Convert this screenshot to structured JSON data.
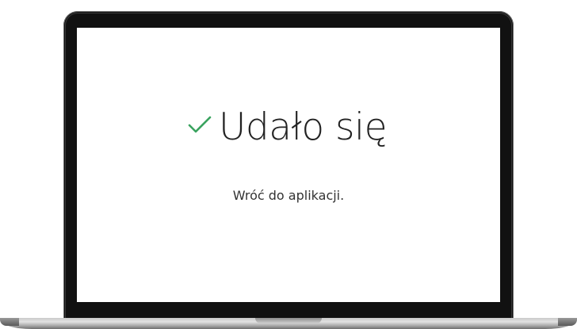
{
  "screen": {
    "title": "Udało się",
    "subtitle": "Wróć do aplikacji."
  },
  "icons": {
    "check": "check-icon"
  },
  "colors": {
    "check": "#3aa35f",
    "title": "#222222",
    "bezel": "#111111",
    "background": "#ffffff"
  }
}
